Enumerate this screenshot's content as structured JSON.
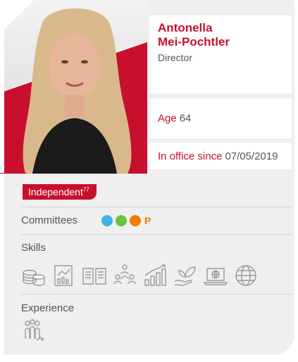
{
  "person": {
    "first_name": "Antonella",
    "last_name": "Mei-Pochtler",
    "role": "Director",
    "age_label": "Age",
    "age_value": "64",
    "since_label": "In office since",
    "since_value": "07/05/2019"
  },
  "status": {
    "label": "Independent",
    "footnote": "77"
  },
  "committees": {
    "label": "Committees",
    "dot_colors": [
      "#3fb5e5",
      "#6ac23e",
      "#f07d00"
    ],
    "chair_marker": "P"
  },
  "skills": {
    "label": "Skills",
    "icons": [
      "coins-icon",
      "report-chart-icon",
      "open-book-icon",
      "team-icon",
      "growth-chart-icon",
      "sustainability-leaf-icon",
      "laptop-globe-icon",
      "globe-icon"
    ]
  },
  "experience": {
    "label": "Experience",
    "icons": [
      "people-growth-icon"
    ]
  },
  "colors": {
    "accent": "#c8102e",
    "text": "#555555",
    "card": "#efefef"
  }
}
